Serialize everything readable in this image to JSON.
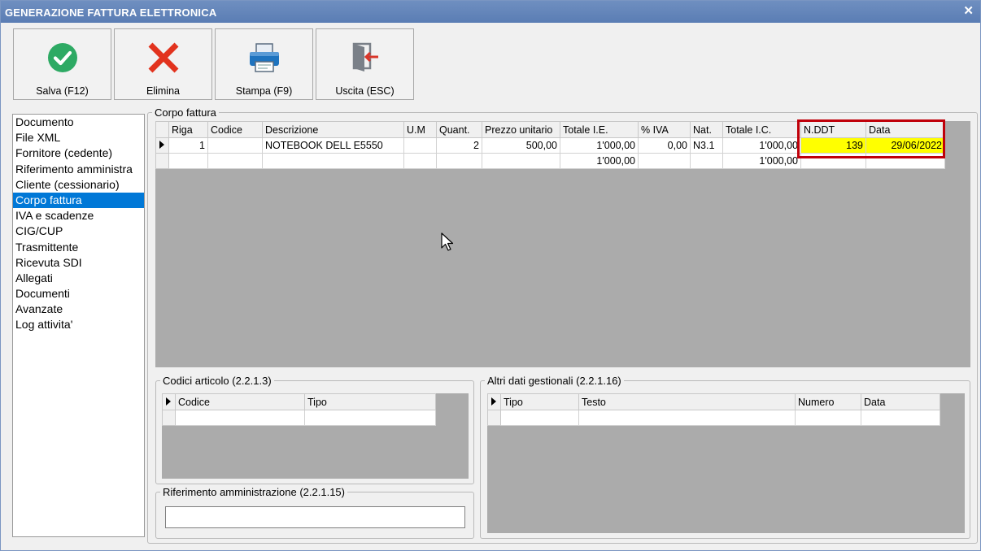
{
  "window": {
    "title": "GENERAZIONE FATTURA ELETTRONICA",
    "close_glyph": "✕"
  },
  "toolbar": {
    "buttons": [
      {
        "label": "Salva (F12)",
        "icon": "check-circle-icon",
        "color": "#2eaa64"
      },
      {
        "label": "Elimina",
        "icon": "x-icon",
        "color": "#e2331e"
      },
      {
        "label": "Stampa (F9)",
        "icon": "printer-icon",
        "color": "#1e73be"
      },
      {
        "label": "Uscita (ESC)",
        "icon": "exit-door-icon",
        "color": "#d9362a"
      }
    ]
  },
  "nav": {
    "items": [
      "Documento",
      "File XML",
      "Fornitore (cedente)",
      "Riferimento amministra",
      "Cliente (cessionario)",
      "Corpo fattura",
      "IVA e scadenze",
      "CIG/CUP",
      "Trasmittente",
      "Ricevuta SDI",
      "Allegati",
      "Documenti",
      "Avanzate",
      "Log attivita'"
    ],
    "selected": "Corpo fattura"
  },
  "corpo": {
    "legend": "Corpo fattura",
    "columns": [
      "Riga",
      "Codice",
      "Descrizione",
      "U.M",
      "Quant.",
      "Prezzo unitario",
      "Totale I.E.",
      "% IVA",
      "Nat.",
      "Totale I.C.",
      "N.DDT",
      "Data"
    ],
    "rows": [
      {
        "riga": "1",
        "codice": "",
        "descrizione": "NOTEBOOK DELL E5550",
        "um": "",
        "quant": "2",
        "prezzo": "500,00",
        "totale_ie": "1'000,00",
        "iva": "0,00",
        "nat": "N3.1",
        "totale_ic": "1'000,00",
        "nddt": "139",
        "data": "29/06/2022"
      }
    ],
    "totals": {
      "totale_ie": "1'000,00",
      "totale_ic": "1'000,00"
    }
  },
  "codici": {
    "legend": "Codici articolo (2.2.1.3)",
    "columns": [
      "Codice",
      "Tipo"
    ]
  },
  "altri": {
    "legend": "Altri dati gestionali (2.2.1.16)",
    "columns": [
      "Tipo",
      "Testo",
      "Numero",
      "Data"
    ]
  },
  "riferimento": {
    "legend": "Riferimento amministrazione (2.2.1.15)",
    "value": ""
  },
  "colors": {
    "highlight_border": "#c0000a",
    "highlight_fill": "#ffff00",
    "selection": "#0078d7",
    "grid_bg": "#ababab"
  }
}
